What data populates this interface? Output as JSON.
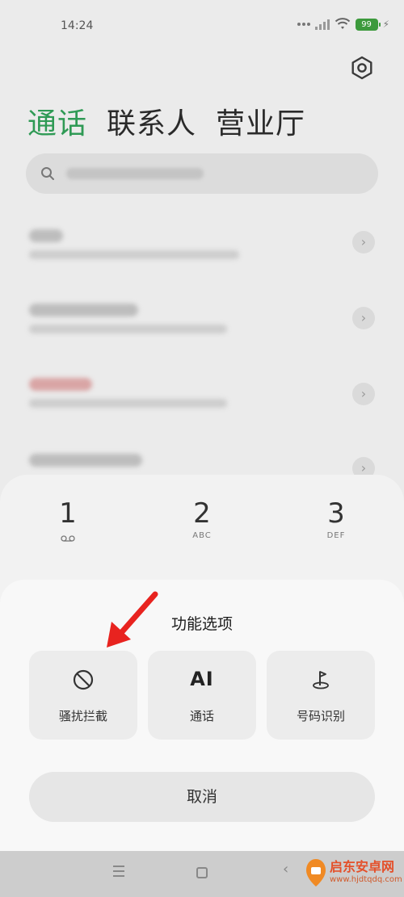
{
  "status": {
    "time": "14:24",
    "battery": "99"
  },
  "tabs": [
    {
      "label": "通话",
      "active": true
    },
    {
      "label": "联系人",
      "active": false
    },
    {
      "label": "营业厅",
      "active": false
    }
  ],
  "dialpad": {
    "keys": [
      {
        "num": "1",
        "sub": ""
      },
      {
        "num": "2",
        "sub": "ABC"
      },
      {
        "num": "3",
        "sub": "DEF"
      }
    ]
  },
  "sheet": {
    "title": "功能选项",
    "options": [
      {
        "label": "骚扰拦截",
        "icon": "block-icon"
      },
      {
        "label": "通话",
        "icon": "ai-icon",
        "glyph": "AI"
      },
      {
        "label": "号码识别",
        "icon": "location-pin-icon"
      }
    ],
    "cancel_label": "取消"
  },
  "watermark": {
    "text": "启东安卓网",
    "url": "www.hjdtqdq.com"
  },
  "colors": {
    "accent": "#2f9a55",
    "annotation_arrow": "#e8231f"
  }
}
